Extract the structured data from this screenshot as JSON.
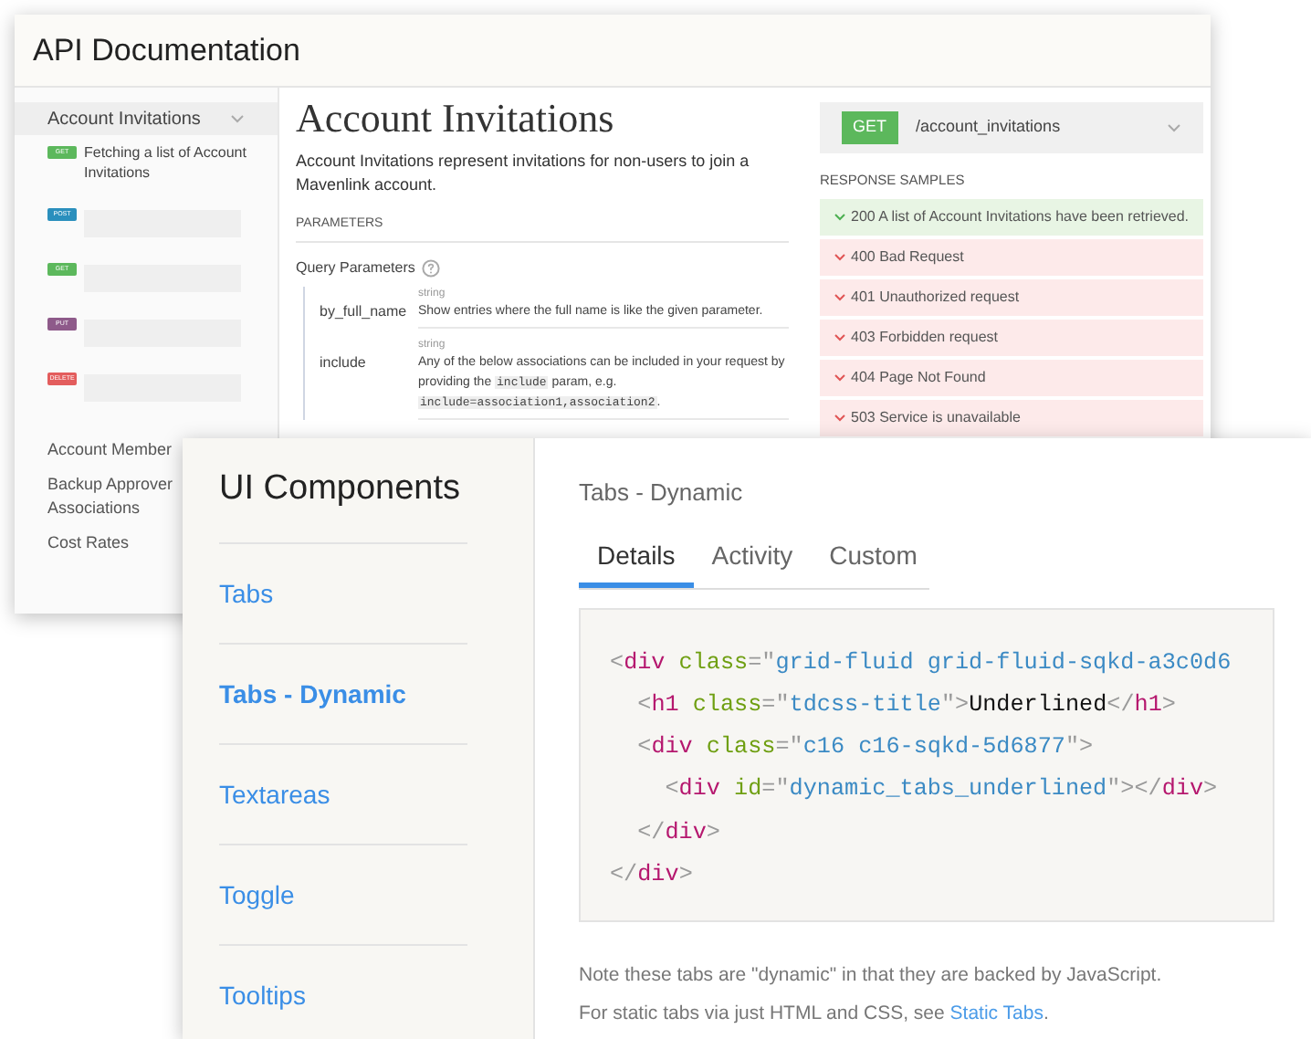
{
  "api_window": {
    "title": "API Documentation",
    "sidebar": {
      "section": {
        "label": "Account Invitations",
        "expanded": true
      },
      "endpoints": [
        {
          "method": "GET",
          "color": "#5cb85c",
          "label": "Fetching a list of Account Invitations"
        },
        {
          "method": "POST",
          "color": "#2a8fbd"
        },
        {
          "method": "GET",
          "color": "#5cb85c"
        },
        {
          "method": "PUT",
          "color": "#8e5a8a"
        },
        {
          "method": "DELETE",
          "color": "#e35d5d"
        }
      ],
      "items": [
        "Account Member",
        "Backup Approver Associations",
        "Cost Rates"
      ]
    },
    "main": {
      "heading": "Account Invitations",
      "description": "Account Invitations represent invitations for non-users to join a Mavenlink account.",
      "parameters_label": "PARAMETERS",
      "query_label": "Query Parameters",
      "params": [
        {
          "name": "by_full_name",
          "type": "string",
          "description": [
            {
              "kind": "text",
              "text": "Show entries where the full name is like the given parameter."
            }
          ]
        },
        {
          "name": "include",
          "type": "string",
          "description": [
            {
              "kind": "text",
              "text": "Any of the below associations can be included in your request by providing the "
            },
            {
              "kind": "code",
              "text": "include"
            },
            {
              "kind": "text",
              "text": " param, e.g. "
            },
            {
              "kind": "code",
              "text": "include=association1,association2"
            },
            {
              "kind": "text",
              "text": "."
            }
          ]
        }
      ]
    },
    "panel": {
      "method": "GET",
      "path": "/account_invitations",
      "samples_label": "RESPONSE SAMPLES",
      "responses": [
        {
          "text": "200 A list of Account Invitations have been retrieved.",
          "kind": "success"
        },
        {
          "text": "400 Bad Request",
          "kind": "error"
        },
        {
          "text": "401 Unauthorized request",
          "kind": "error"
        },
        {
          "text": "403 Forbidden request",
          "kind": "error"
        },
        {
          "text": "404 Page Not Found",
          "kind": "error"
        },
        {
          "text": "503 Service is unavailable",
          "kind": "error"
        }
      ]
    }
  },
  "components_window": {
    "title": "UI Components",
    "nav": [
      {
        "label": "Tabs",
        "selected": false
      },
      {
        "label": "Tabs - Dynamic",
        "selected": true
      },
      {
        "label": "Textareas",
        "selected": false
      },
      {
        "label": "Toggle",
        "selected": false
      },
      {
        "label": "Tooltips",
        "selected": false
      }
    ],
    "page_title": "Tabs - Dynamic",
    "tabs": [
      {
        "label": "Details",
        "selected": true
      },
      {
        "label": "Activity",
        "selected": false
      },
      {
        "label": "Custom",
        "selected": false
      }
    ],
    "code": [
      [
        {
          "kind": "punct",
          "text": "<"
        },
        {
          "kind": "tag",
          "text": "div"
        },
        {
          "kind": "attr",
          "text": " class"
        },
        {
          "kind": "punct",
          "text": "=\""
        },
        {
          "kind": "string",
          "text": "grid-fluid grid-fluid-sqkd-a3c0d6"
        }
      ],
      [
        {
          "kind": "punct",
          "text": "  <"
        },
        {
          "kind": "tag",
          "text": "h1"
        },
        {
          "kind": "attr",
          "text": " class"
        },
        {
          "kind": "punct",
          "text": "=\""
        },
        {
          "kind": "string",
          "text": "tdcss-title"
        },
        {
          "kind": "punct",
          "text": "\">"
        },
        {
          "kind": "text",
          "text": "Underlined"
        },
        {
          "kind": "punct",
          "text": "</"
        },
        {
          "kind": "tag",
          "text": "h1"
        },
        {
          "kind": "punct",
          "text": ">"
        }
      ],
      [
        {
          "kind": "punct",
          "text": "  <"
        },
        {
          "kind": "tag",
          "text": "div"
        },
        {
          "kind": "attr",
          "text": " class"
        },
        {
          "kind": "punct",
          "text": "=\""
        },
        {
          "kind": "string",
          "text": "c16 c16-sqkd-5d6877"
        },
        {
          "kind": "punct",
          "text": "\">"
        }
      ],
      [
        {
          "kind": "punct",
          "text": "    <"
        },
        {
          "kind": "tag",
          "text": "div"
        },
        {
          "kind": "attr",
          "text": " id"
        },
        {
          "kind": "punct",
          "text": "=\""
        },
        {
          "kind": "string",
          "text": "dynamic_tabs_underlined"
        },
        {
          "kind": "punct",
          "text": "\"></"
        },
        {
          "kind": "tag",
          "text": "div"
        },
        {
          "kind": "punct",
          "text": ">"
        }
      ],
      [
        {
          "kind": "punct",
          "text": "  </"
        },
        {
          "kind": "tag",
          "text": "div"
        },
        {
          "kind": "punct",
          "text": ">"
        }
      ],
      [
        {
          "kind": "punct",
          "text": "</"
        },
        {
          "kind": "tag",
          "text": "div"
        },
        {
          "kind": "punct",
          "text": ">"
        }
      ]
    ],
    "notes": [
      {
        "text": "Note these tabs are \"dynamic\" in that they are backed by JavaScript."
      },
      {
        "text": "For static tabs via just HTML and CSS, see ",
        "link": "Static Tabs",
        "after": "."
      }
    ]
  }
}
